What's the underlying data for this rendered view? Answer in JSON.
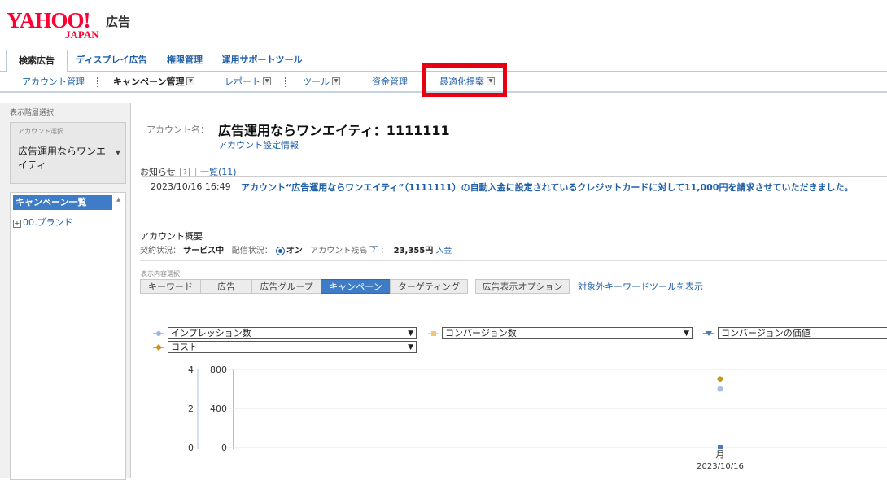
{
  "header": {
    "logo_main": "YAHOO!",
    "logo_sub": "JAPAN",
    "logo_suffix": "広告"
  },
  "main_tabs": [
    {
      "label": "検索広告",
      "active": true
    },
    {
      "label": "ディスプレイ広告",
      "active": false
    },
    {
      "label": "権限管理",
      "active": false
    },
    {
      "label": "運用サポートツール",
      "active": false
    }
  ],
  "sub_nav": [
    {
      "label": "アカウント管理"
    },
    {
      "label": "キャンペーン管理"
    },
    {
      "label": "レポート"
    },
    {
      "label": "ツール"
    },
    {
      "label": "資金管理"
    },
    {
      "label": "最適化提案"
    }
  ],
  "left": {
    "title": "表示階層選択",
    "account_select_label": "アカウント選択",
    "account_select_value": "広告運用ならワンエイティ",
    "campaign_list_header": "キャンペーン一覧",
    "campaign_item": "00.ブランド"
  },
  "account": {
    "label": "アカウント名：",
    "name": "広告運用ならワンエイティ：1111111",
    "settings_link": "アカウント設定情報"
  },
  "notice": {
    "label": "お知らせ",
    "help": "?",
    "list_link": "一覧(11)",
    "date": "2023/10/16 16:49",
    "text": "アカウント“広告運用ならワンエイティ”（1111111）の自動入金に設定されているクレジットカードに対して11,000円を請求させていただきました。"
  },
  "summary": {
    "title": "アカウント概要",
    "contract_label": "契約状況：",
    "contract_value": "サービス中",
    "delivery_label": "配信状況：",
    "delivery_value": "オン",
    "balance_label": "アカウント残高",
    "balance_help": "?",
    "balance_colon": "：",
    "balance_value": "23,355円",
    "deposit_link": "入金"
  },
  "view": {
    "label": "表示内容選択",
    "tabs": [
      {
        "label": "キーワード",
        "active": false
      },
      {
        "label": "広告",
        "active": false
      },
      {
        "label": "広告グループ",
        "active": false
      },
      {
        "label": "キャンペーン",
        "active": true
      },
      {
        "label": "ターゲティング",
        "active": false
      },
      {
        "label": "広告表示オプション",
        "active": false
      }
    ],
    "keyword_tool_link": "対象外キーワードツールを表示"
  },
  "chart_selectors": [
    {
      "value": "インプレッション数",
      "color": "#9bb8e0"
    },
    {
      "value": "コンバージョン数",
      "color": "#f0c878"
    },
    {
      "value": "コンバージョンの価値",
      "color": "#4a78b8"
    },
    {
      "value": "コスト",
      "color": "#c8961e"
    }
  ],
  "chart_data": {
    "type": "scatter",
    "left_axis_ticks": [
      "4",
      "2",
      "0"
    ],
    "left_axis_range": [
      0,
      4
    ],
    "second_axis_ticks": [
      "800",
      "400",
      "0"
    ],
    "second_axis_range": [
      0,
      800
    ],
    "x_tick_top": "月",
    "x_tick_bottom": "2023/10/16",
    "series": [
      {
        "name": "インプレッション数",
        "marker": "circle",
        "color": "#a8c0e8",
        "axis": "left",
        "x": "2023/10/16",
        "y": 3
      },
      {
        "name": "コスト",
        "marker": "diamond",
        "color": "#c8961e",
        "axis": "left",
        "x": "2023/10/16",
        "y": 3.5
      },
      {
        "name": "コンバージョン数",
        "marker": "square",
        "color": "#4a78b8",
        "axis": "left",
        "x": "2023/10/16",
        "y": 0
      }
    ]
  }
}
